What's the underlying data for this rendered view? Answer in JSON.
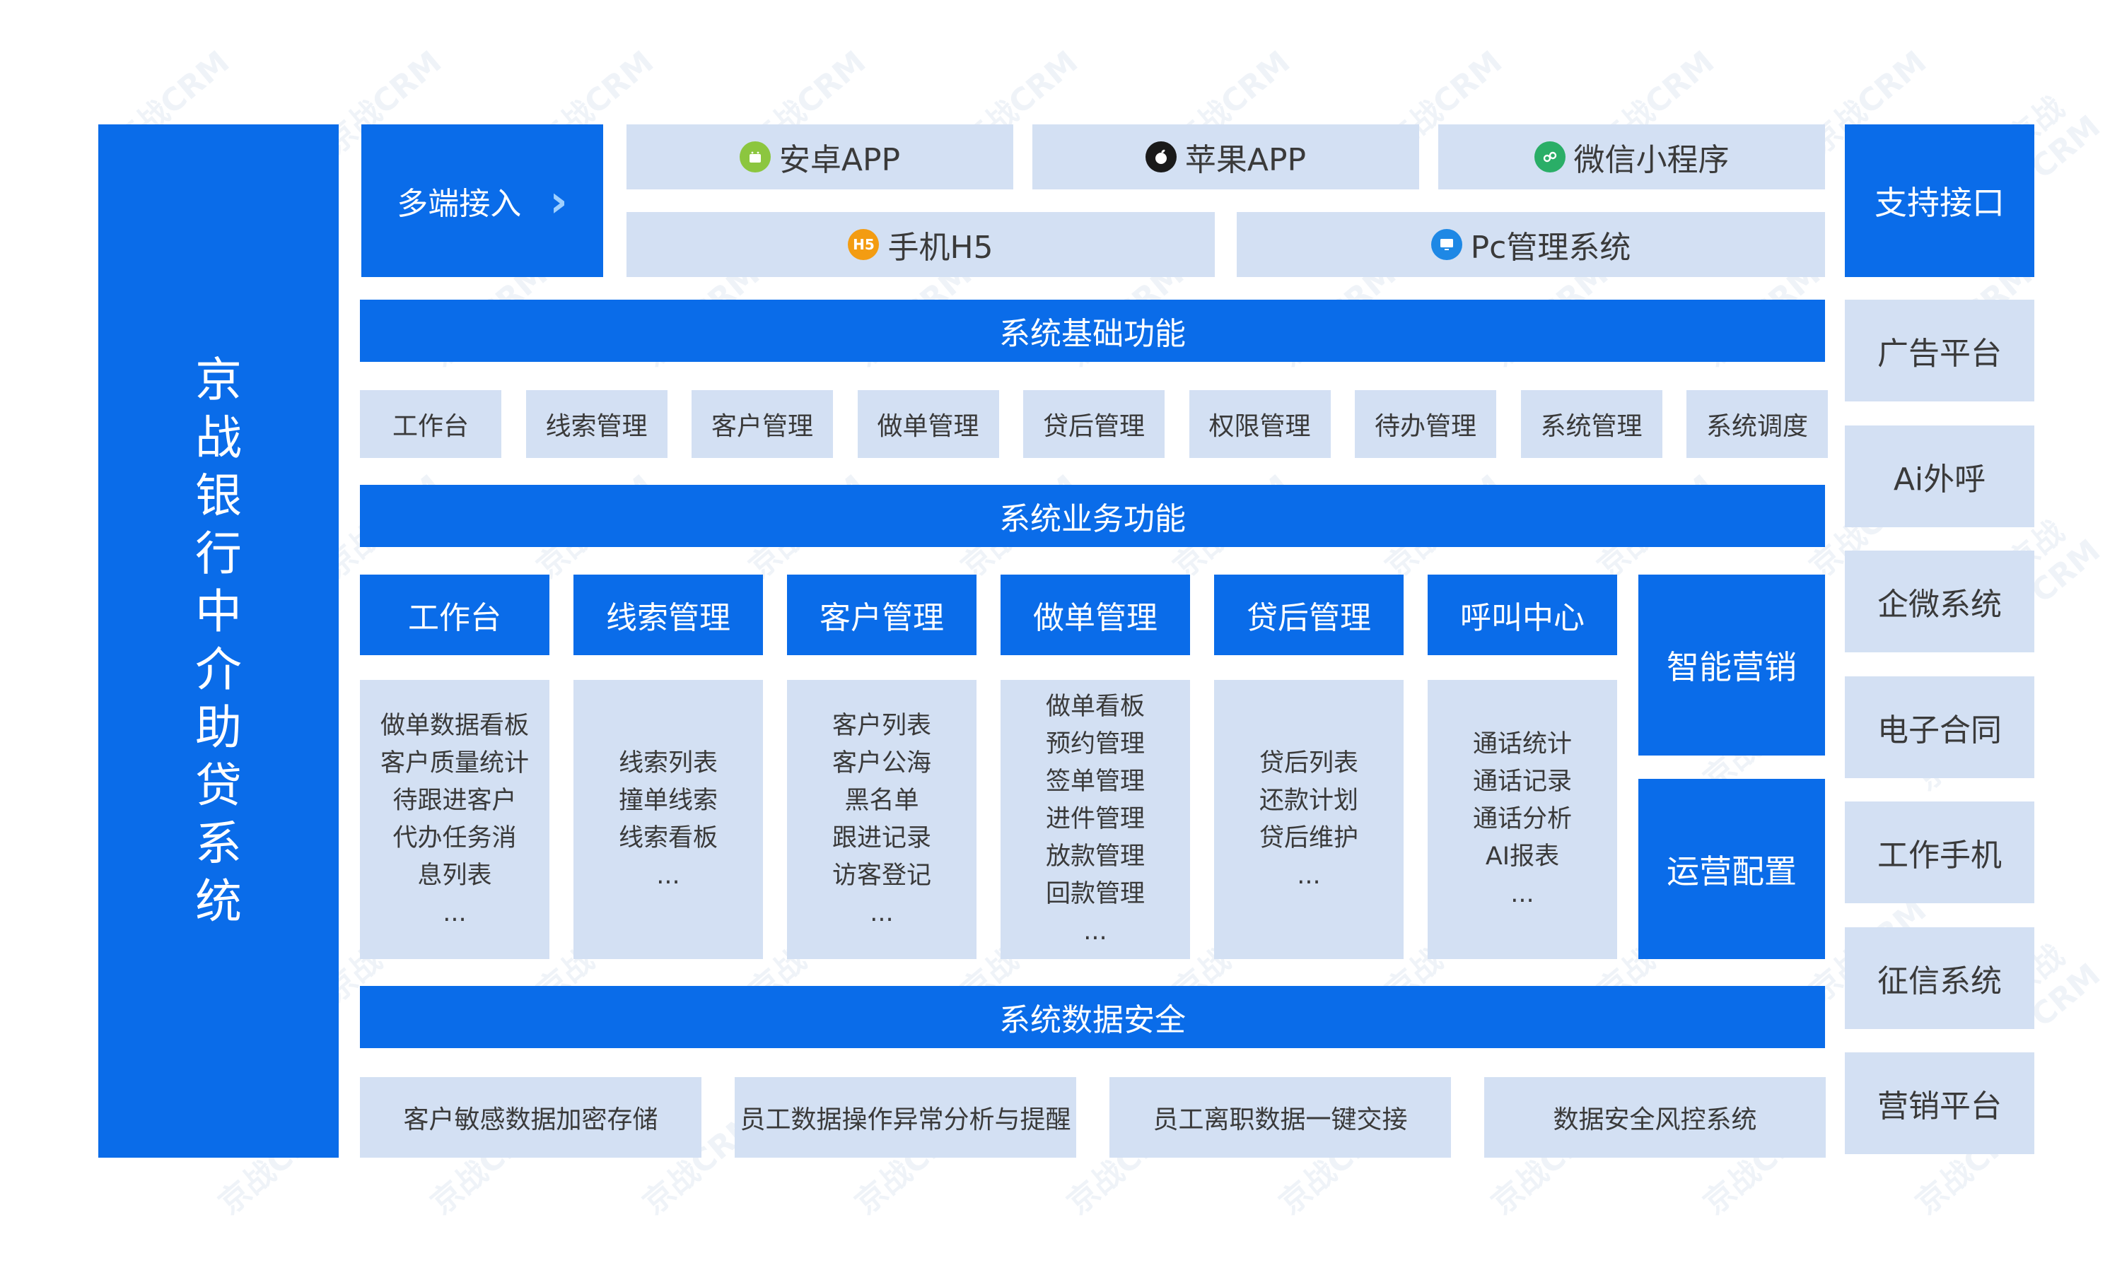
{
  "left_title": [
    "京",
    "战",
    "银",
    "行",
    "中",
    "介",
    "助",
    "贷",
    "系",
    "统"
  ],
  "access": {
    "label": "多端接入",
    "arrow": "›",
    "platforms": [
      {
        "label": "安卓APP",
        "icon": "android-icon",
        "color": "#8cc63f"
      },
      {
        "label": "苹果APP",
        "icon": "apple-icon",
        "color": "#1a1a1a"
      },
      {
        "label": "微信小程序",
        "icon": "wechat-miniprogram-icon",
        "color": "#2aae67"
      },
      {
        "label": "手机H5",
        "icon": "h5-icon",
        "icon_text": "H5",
        "color": "#f39c12"
      },
      {
        "label": "Pc管理系统",
        "icon": "monitor-icon",
        "color": "#1e88e5"
      }
    ]
  },
  "basic_bar": "系统基础功能",
  "basic_items": [
    "工作台",
    "线索管理",
    "客户管理",
    "做单管理",
    "贷后管理",
    "权限管理",
    "待办管理",
    "系统管理",
    "系统调度"
  ],
  "business_bar": "系统业务功能",
  "modules": [
    {
      "title": "工作台",
      "items": [
        "做单数据看板",
        "客户质量统计",
        "待跟进客户",
        "代办任务消",
        "息列表",
        "..."
      ]
    },
    {
      "title": "线索管理",
      "items": [
        "线索列表",
        "撞单线索",
        "线索看板",
        "..."
      ]
    },
    {
      "title": "客户管理",
      "items": [
        "客户列表",
        "客户公海",
        "黑名单",
        "跟进记录",
        "访客登记",
        "..."
      ]
    },
    {
      "title": "做单管理",
      "items": [
        "做单看板",
        "预约管理",
        "签单管理",
        "进件管理",
        "放款管理",
        "回款管理",
        "..."
      ]
    },
    {
      "title": "贷后管理",
      "items": [
        "贷后列表",
        "还款计划",
        "贷后维护",
        "..."
      ]
    },
    {
      "title": "呼叫中心",
      "items": [
        "通话统计",
        "通话记录",
        "通话分析",
        "AI报表",
        "..."
      ]
    }
  ],
  "smart_marketing": "智能营销",
  "ops_config": "运营配置",
  "security_bar": "系统数据安全",
  "security_items": [
    "客户敏感数据加密存储",
    "员工数据操作异常分析与提醒",
    "员工离职数据一键交接",
    "数据安全风控系统"
  ],
  "interfaces": {
    "title": "支持接口",
    "items": [
      "广告平台",
      "Ai外呼",
      "企微系统",
      "电子合同",
      "工作手机",
      "征信系统",
      "营销平台"
    ]
  },
  "watermark": "京战CRM",
  "colors": {
    "primary": "#0a6ce9",
    "light": "#d3e0f3",
    "text": "#3a3a3a"
  }
}
